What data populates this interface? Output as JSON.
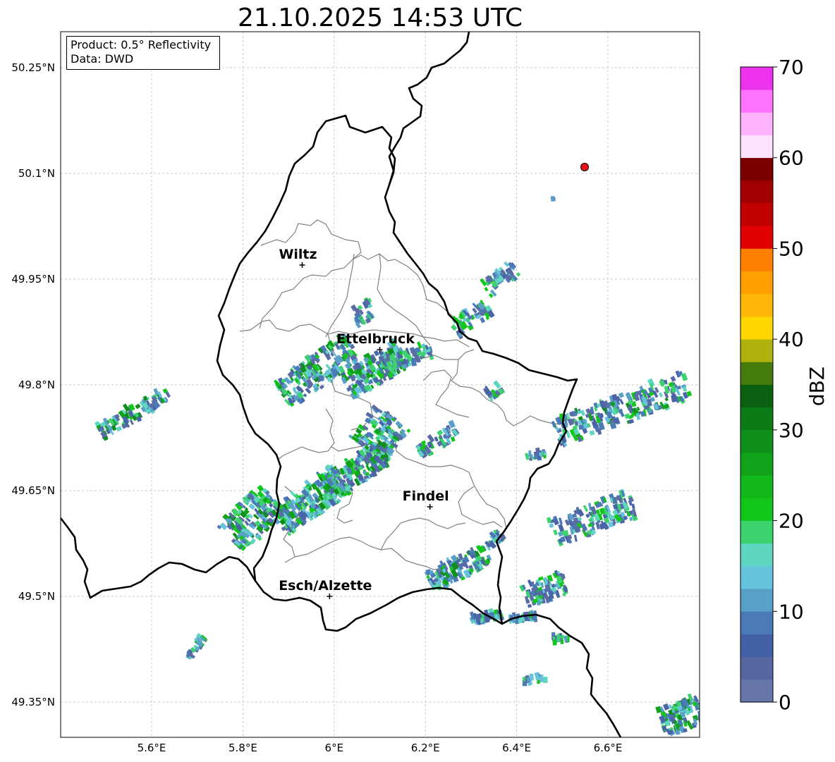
{
  "title": "21.10.2025 14:53 UTC",
  "info_box": {
    "product": "Product: 0.5° Reflectivity",
    "source": "Data: DWD"
  },
  "map": {
    "lat_ticks": [
      "50.25°N",
      "50.1°N",
      "49.95°N",
      "49.8°N",
      "49.65°N",
      "49.5°N",
      "49.35°N"
    ],
    "lon_ticks": [
      "5.6°E",
      "5.8°E",
      "6°E",
      "6.2°E",
      "6.4°E",
      "6.6°E"
    ],
    "gridlines": true,
    "radar_site_color": "#e8141a",
    "cities": [
      {
        "name": "Wiltz",
        "lon": 5.93,
        "lat": 49.97
      },
      {
        "name": "Ettelbruck",
        "lon": 6.1,
        "lat": 49.85
      },
      {
        "name": "Findel",
        "lon": 6.21,
        "lat": 49.627
      },
      {
        "name": "Esch/Alzette",
        "lon": 5.99,
        "lat": 49.5
      }
    ]
  },
  "colorbar": {
    "label": "dBZ",
    "ticks": [
      "0",
      "10",
      "20",
      "30",
      "40",
      "50",
      "60",
      "70"
    ],
    "colors": [
      "#6675aa",
      "#5566a0",
      "#4460a4",
      "#4a7bb6",
      "#58a0c8",
      "#66c3dc",
      "#5fd6c1",
      "#3cd26e",
      "#12c71a",
      "#12b71a",
      "#10a31a",
      "#0e8f1a",
      "#0c7a16",
      "#0a6010",
      "#457a0d",
      "#b0b10c",
      "#ffd700",
      "#ffb606",
      "#ff9f00",
      "#ff7f00",
      "#e00000",
      "#c10000",
      "#a00000",
      "#7a0000",
      "#ffe2ff",
      "#ffb3ff",
      "#ff73ff",
      "#ee33ee"
    ]
  }
}
